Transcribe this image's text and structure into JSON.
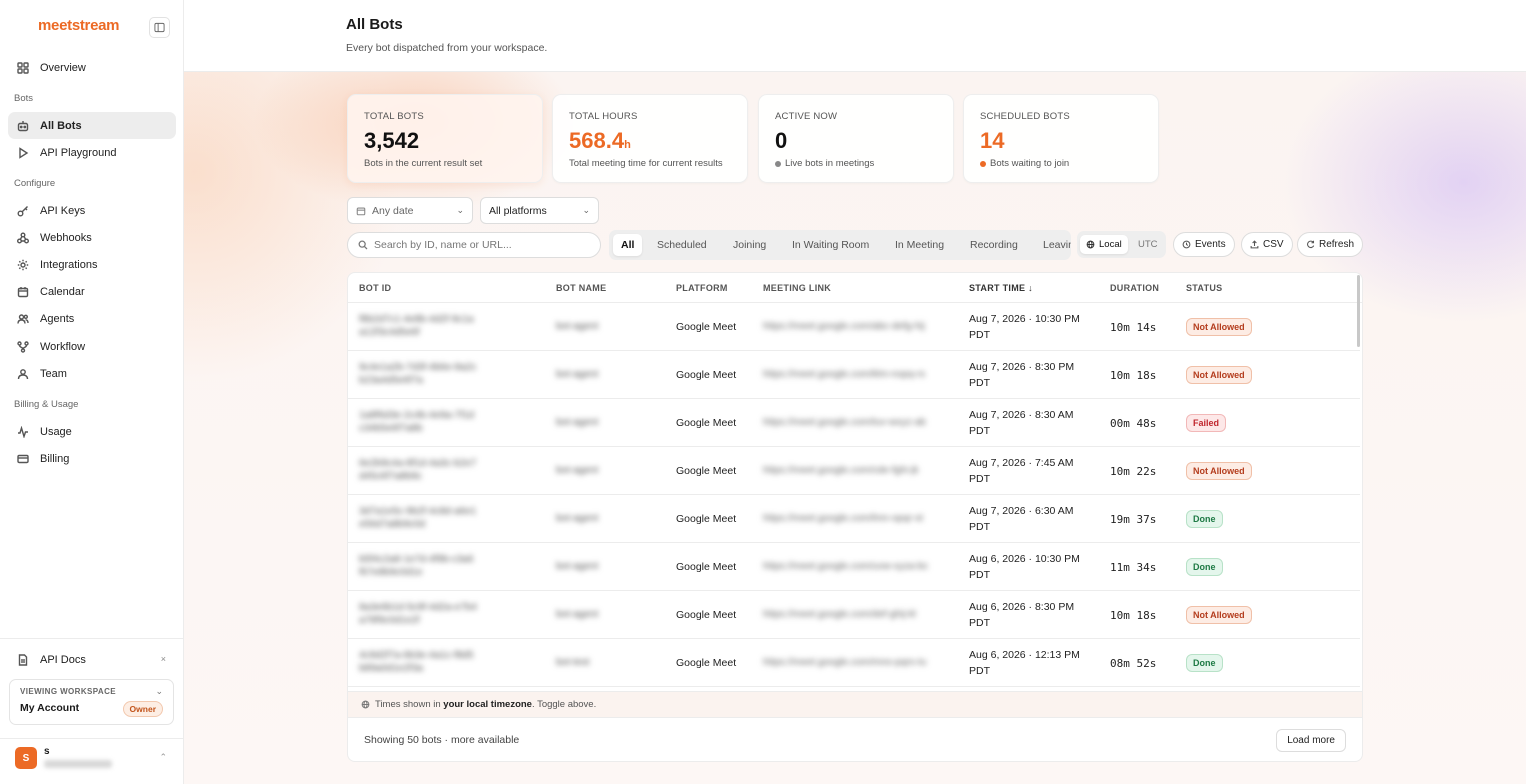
{
  "sidebar": {
    "logo": "meetstream",
    "overview": "Overview",
    "section_bots": "Bots",
    "all_bots": "All Bots",
    "api_playground": "API Playground",
    "section_configure": "Configure",
    "api_keys": "API Keys",
    "webhooks": "Webhooks",
    "integrations": "Integrations",
    "calendar": "Calendar",
    "agents": "Agents",
    "workflow": "Workflow",
    "team": "Team",
    "section_billing": "Billing & Usage",
    "usage": "Usage",
    "billing": "Billing",
    "api_docs": "API Docs",
    "workspace_label": "VIEWING WORKSPACE",
    "workspace_name": "My Account",
    "workspace_role": "Owner",
    "user_initial": "S",
    "user_name": "s"
  },
  "header": {
    "title": "All Bots",
    "subtitle": "Every bot dispatched from your workspace."
  },
  "stats": [
    {
      "label": "TOTAL BOTS",
      "value": "3,542",
      "unit": "",
      "sub": "Bots in the current result set"
    },
    {
      "label": "TOTAL HOURS",
      "value": "568.4",
      "unit": "h",
      "sub": "Total meeting time for current results"
    },
    {
      "label": "ACTIVE NOW",
      "value": "0",
      "unit": "",
      "sub": "Live bots in meetings"
    },
    {
      "label": "SCHEDULED BOTS",
      "value": "14",
      "unit": "",
      "sub": "Bots waiting to join"
    }
  ],
  "colors": {
    "accent": "#ec6a25",
    "grey_dot": "#888888"
  },
  "filters": {
    "date": "Any date",
    "platform": "All platforms",
    "search_placeholder": "Search by ID, name or URL..."
  },
  "tabs": [
    "All",
    "Scheduled",
    "Joining",
    "In Waiting Room",
    "In Meeting",
    "Recording",
    "Leaving"
  ],
  "timezone": {
    "local": "Local",
    "utc": "UTC"
  },
  "actions": {
    "events": "Events",
    "csv": "CSV",
    "refresh": "Refresh"
  },
  "table": {
    "headers": {
      "bot_id": "BOT ID",
      "bot_name": "BOT NAME",
      "platform": "PLATFORM",
      "meeting_link": "MEETING LINK",
      "start_time": "START TIME ↓",
      "duration": "DURATION",
      "status": "STATUS"
    },
    "rows": [
      {
        "id1": "f8b2d7c1-4e8b-4d2f-9c1a",
        "id2": "a12f3c4d5e6f",
        "name": "bot-agent",
        "platform": "Google Meet",
        "link": "https://meet.google.com/abc-defg-hij",
        "date": "Aug 7, 2026 · 10:30 PM",
        "tz": "PDT",
        "duration": "10m 14s",
        "status": "Not Allowed"
      },
      {
        "id1": "9c4e1a2b-7d3f-4b6e-8a2c",
        "id2": "b23a4d5e6f7a",
        "name": "bot-agent",
        "platform": "Google Meet",
        "link": "https://meet.google.com/klm-nopq-rs",
        "date": "Aug 7, 2026 · 8:30 PM",
        "tz": "PDT",
        "duration": "10m 18s",
        "status": "Not Allowed"
      },
      {
        "id1": "1a8f6d3e-2c4b-4e9a-7f1d",
        "id2": "c34b5e6f7a8b",
        "name": "bot-agent",
        "platform": "Google Meet",
        "link": "https://meet.google.com/tuv-wxyz-ab",
        "date": "Aug 7, 2026 · 8:30 AM",
        "tz": "PDT",
        "duration": "00m 48s",
        "status": "Failed"
      },
      {
        "id1": "6e2b9c4a-8f1d-4a3c-b2e7",
        "id2": "d45c6f7a8b9c",
        "name": "bot-agent",
        "platform": "Google Meet",
        "link": "https://meet.google.com/cde-fghi-jk",
        "date": "Aug 7, 2026 · 7:45 AM",
        "tz": "PDT",
        "duration": "10m 22s",
        "status": "Not Allowed"
      },
      {
        "id1": "3d7a1e5c-9b2f-4c8d-a6e1",
        "id2": "e56d7a8b9c0d",
        "name": "bot-agent",
        "platform": "Google Meet",
        "link": "https://meet.google.com/lmn-opqr-st",
        "date": "Aug 7, 2026 · 6:30 AM",
        "tz": "PDT",
        "duration": "19m 37s",
        "status": "Done"
      },
      {
        "id1": "b5f4c2a8-1e7d-4f9b-c3a6",
        "id2": "f67e8b9c0d1e",
        "name": "bot-agent",
        "platform": "Google Meet",
        "link": "https://meet.google.com/uvw-xyza-bc",
        "date": "Aug 6, 2026 · 10:30 PM",
        "tz": "PDT",
        "duration": "11m 34s",
        "status": "Done"
      },
      {
        "id1": "8a3e6b1d-5c9f-4d2a-e7b4",
        "id2": "a78f9c0d1e2f",
        "name": "bot-agent",
        "platform": "Google Meet",
        "link": "https://meet.google.com/def-ghij-kl",
        "date": "Aug 6, 2026 · 8:30 PM",
        "tz": "PDT",
        "duration": "10m 18s",
        "status": "Not Allowed"
      },
      {
        "id1": "4c9d2f7a-6b3e-4a1c-f8d5",
        "id2": "b89a0d1e2f3a",
        "name": "bot-test",
        "platform": "Google Meet",
        "link": "https://meet.google.com/mno-pqrs-tu",
        "date": "Aug 6, 2026 · 12:13 PM",
        "tz": "PDT",
        "duration": "08m 52s",
        "status": "Done"
      }
    ]
  },
  "footer": {
    "tz_prefix": "Times shown in ",
    "tz_bold": "your local timezone",
    "tz_suffix": ". Toggle above.",
    "showing": "Showing 50 bots · more available",
    "load_more": "Load more"
  }
}
